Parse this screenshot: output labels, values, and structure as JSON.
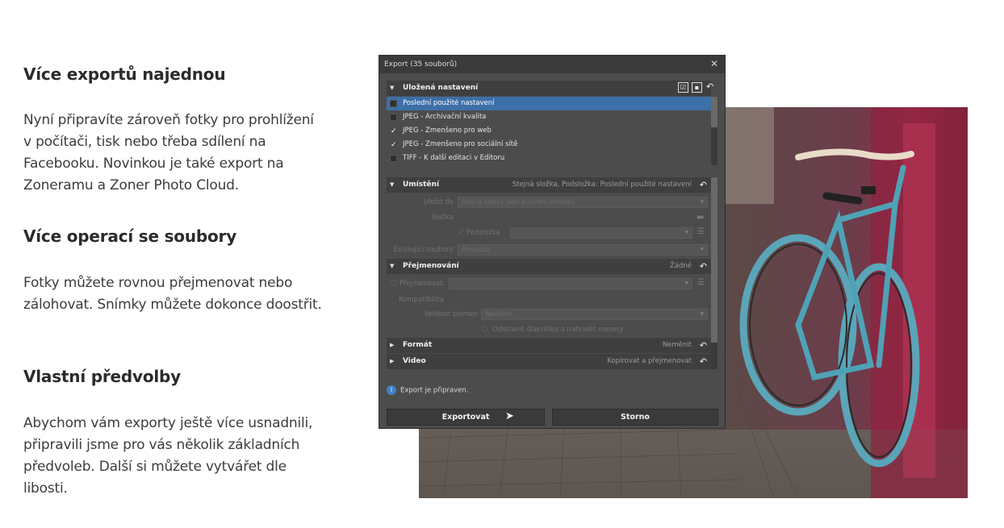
{
  "features": [
    {
      "heading": "Více exportů najednou",
      "text": "Nyní připravíte zároveň fotky pro prohlížení v počítači, tisk nebo třeba sdílení na Facebooku. Novinkou je také export na Zoneramu a Zoner Photo Cloud."
    },
    {
      "heading": "Více operací se soubory",
      "text": "Fotky můžete rovnou přejmenovat nebo zálohovat. Snímky můžete dokonce doostřit."
    },
    {
      "heading": "Vlastní předvolby",
      "text": "Abychom vám exporty ještě více usnadnili, připravili jsme pro vás několik základních předvoleb. Další si můžete vytvářet dle libosti."
    }
  ],
  "dialog": {
    "title": "Export (35 souborů)",
    "close_glyph": "✕",
    "sections": {
      "saved": {
        "label": "Uložená nastavení"
      },
      "location": {
        "label": "Umístění",
        "value": "Stejná složka, Podsložka: Poslední použité nastavení"
      },
      "rename": {
        "label": "Přejmenování",
        "value": "Žádné"
      },
      "format": {
        "label": "Formát",
        "value": "Neměnit"
      },
      "video": {
        "label": "Video",
        "value": "Kopírovat a přejmenovat"
      }
    },
    "presets": [
      {
        "label": "Poslední použité nastavení",
        "checked": false,
        "selected": true
      },
      {
        "label": "JPEG - Archivační kvalita",
        "checked": false,
        "selected": false
      },
      {
        "label": "JPEG - Zmenšeno pro web",
        "checked": true,
        "selected": false
      },
      {
        "label": "JPEG - Zmenšeno pro sociální sítě",
        "checked": true,
        "selected": false
      },
      {
        "label": "TIFF - K další editaci v Editoru",
        "checked": false,
        "selected": false
      }
    ],
    "location_fields": {
      "save_to_label": "Uložit do",
      "save_to_value": "Stejné složky jako původní obrázek",
      "folder_label": "Složka",
      "subfolder_label": "Podsložka",
      "existing_label": "Existující soubory",
      "existing_value": "Přeskočit"
    },
    "rename_fields": {
      "rename_label": "Přejmenovat",
      "compat_label": "Kompatibilita",
      "case_label": "Velikost písmen",
      "case_value": "Neměnit",
      "diacritics_label": "Odstranit diakritiku a nahradit mezery"
    },
    "status": "Export je připraven.",
    "export_button": "Exportovat",
    "cancel_button": "Storno"
  },
  "colors": {
    "selection": "#3d6fa8",
    "dialog_bg": "#4c4c4c",
    "info_blue": "#3f83c9"
  },
  "icons": [
    "select-all-icon",
    "save-icon",
    "revert-icon",
    "folder-icon",
    "list-icon",
    "info-icon",
    "close-icon",
    "cursor-icon"
  ]
}
